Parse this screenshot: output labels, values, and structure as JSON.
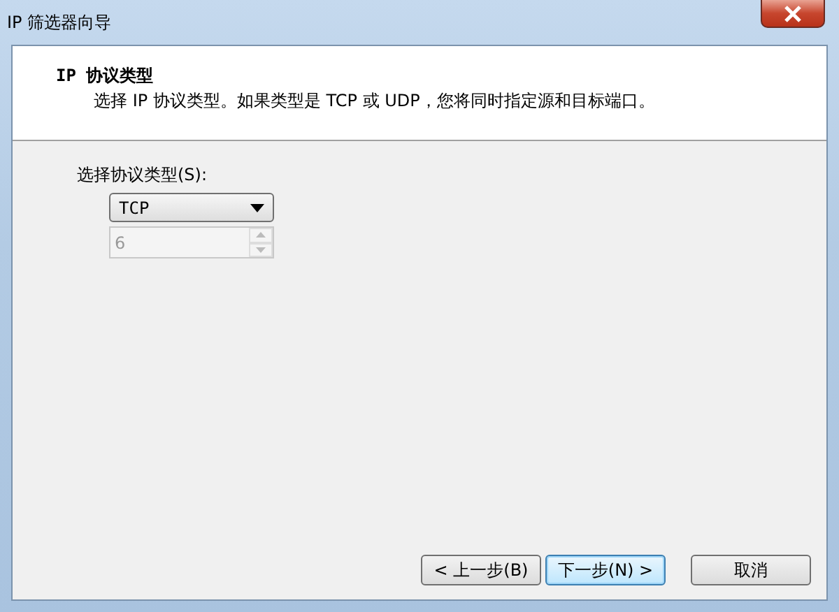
{
  "window": {
    "title": "IP 筛选器向导"
  },
  "header": {
    "title": "IP 协议类型",
    "description": "选择 IP 协议类型。如果类型是 TCP 或 UDP，您将同时指定源和目标端口。"
  },
  "protocol": {
    "label": "选择协议类型(S):",
    "value": "TCP"
  },
  "protocol_number": {
    "value": "6",
    "disabled": true
  },
  "buttons": [
    {
      "label": "< 上一步(B)",
      "default": false
    },
    {
      "label": "下一步(N) >",
      "default": true
    },
    {
      "label": "取消",
      "default": false
    }
  ]
}
